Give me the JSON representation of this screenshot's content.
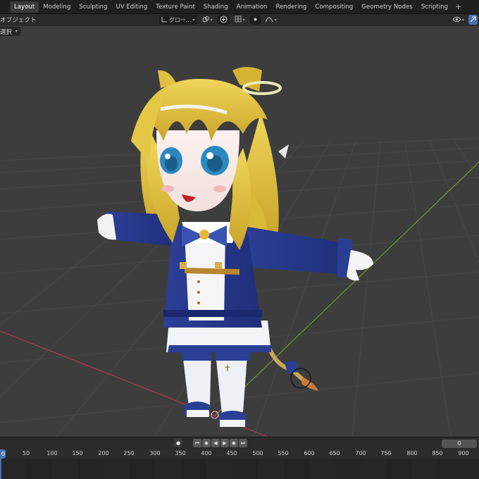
{
  "workspace_tabs": [
    "Layout",
    "Modeling",
    "Sculpting",
    "UV Editing",
    "Texture Paint",
    "Shading",
    "Animation",
    "Rendering",
    "Compositing",
    "Geometry Nodes",
    "Scripting"
  ],
  "active_tab": "Layout",
  "header": {
    "object_menu": "オブジェクト",
    "transform_orientation": "グロー...",
    "select_mode": "選択"
  },
  "timeline": {
    "current_frame_marker": "0",
    "current_frame_field": "0",
    "ticks": [
      "50",
      "100",
      "150",
      "200",
      "250",
      "300",
      "350",
      "400",
      "450",
      "500",
      "550",
      "600",
      "650",
      "700",
      "750",
      "800",
      "850",
      "900"
    ]
  },
  "colors": {
    "accent": "#4772b3",
    "x_axis": "#b3384a",
    "y_axis": "#6a9a2e",
    "viewport_bg": "#3d3d3d",
    "coat_blue": "#2a3f93",
    "hair_yellow": "#e2c53a"
  },
  "icons": [
    "viewport-shading-icon",
    "pivot-icon",
    "snap-icon",
    "proportional-edit-icon",
    "play-icon",
    "rewind-icon",
    "record-icon"
  ]
}
